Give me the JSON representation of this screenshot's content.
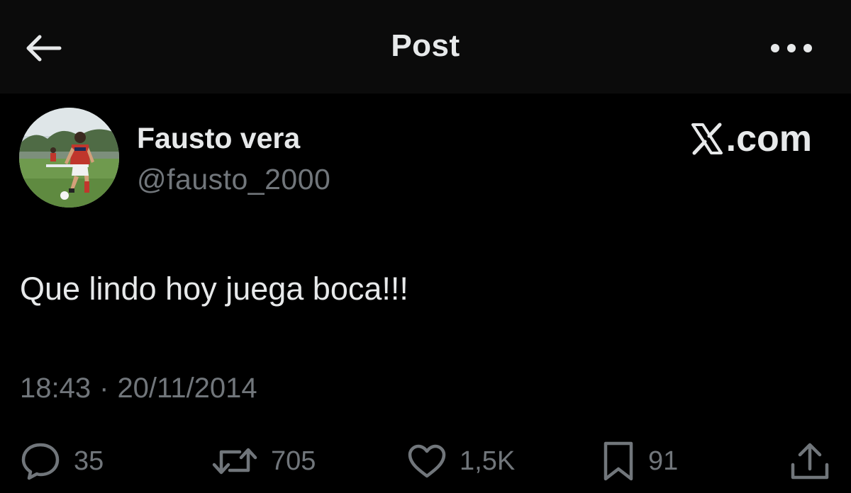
{
  "header": {
    "title": "Post",
    "back_icon": "arrow-left-icon",
    "more_icon": "more-horizontal-icon"
  },
  "author": {
    "name": "Fausto vera",
    "handle": "@fausto_2000",
    "avatar": "avatar-football-player-photo"
  },
  "brand": {
    "logo_icon": "x-logo-icon",
    "text": ".com"
  },
  "post": {
    "text": "Que lindo hoy juega boca!!!",
    "time": "18:43",
    "separator": "·",
    "date": "20/11/2014"
  },
  "actions": {
    "reply": {
      "icon": "reply-bubble-icon",
      "count": "35"
    },
    "repost": {
      "icon": "repost-icon",
      "count": "705"
    },
    "like": {
      "icon": "heart-icon",
      "count": "1,5K"
    },
    "bookmark": {
      "icon": "bookmark-icon",
      "count": "91"
    },
    "share": {
      "icon": "share-icon"
    }
  },
  "colors": {
    "background": "#000000",
    "header_background": "#0b0b0b",
    "primary_text": "#e7e9ea",
    "secondary_text": "#71767b"
  }
}
